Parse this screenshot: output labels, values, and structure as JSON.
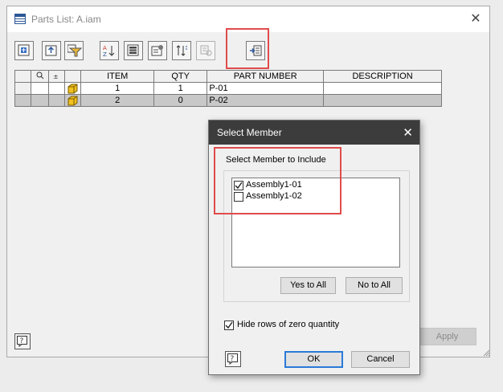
{
  "window": {
    "title": "Parts List: A.iam",
    "close_glyph": "✕"
  },
  "toolbar": {
    "buttons": [
      {
        "name": "member-select-icon"
      },
      {
        "name": "export-icon"
      },
      {
        "name": "filter-funnel-icon"
      },
      {
        "name": "sort-az-icon"
      },
      {
        "name": "column-chooser-icon"
      },
      {
        "name": "group-settings-icon"
      },
      {
        "name": "renumber-icon"
      },
      {
        "name": "settings-grid-icon"
      },
      {
        "name": "member-include-icon"
      }
    ]
  },
  "grid": {
    "columns": [
      "",
      "",
      "",
      "",
      "ITEM",
      "QTY",
      "PART NUMBER",
      "DESCRIPTION"
    ],
    "rows": [
      {
        "item": "1",
        "qty": "1",
        "part_number": "P-01",
        "description": ""
      },
      {
        "item": "2",
        "qty": "0",
        "part_number": "P-02",
        "description": ""
      }
    ]
  },
  "footer": {
    "apply_label": "Apply"
  },
  "dialog": {
    "title": "Select Member",
    "close_glyph": "✕",
    "prompt": "Select Member to Include",
    "members": [
      {
        "label": "Assembly1-01",
        "checked": true
      },
      {
        "label": "Assembly1-02",
        "checked": false
      }
    ],
    "yes_to_all_label": "Yes to All",
    "no_to_all_label": "No to All",
    "hide_zero_label": "Hide rows of zero quantity",
    "hide_zero_checked": true,
    "ok_label": "OK",
    "cancel_label": "Cancel"
  },
  "colors": {
    "highlight": "#e04b4b",
    "selected_row": "#c8c8c8",
    "dialog_titlebar": "#3c3c3c",
    "ok_border": "#2a7ad8",
    "part_cube": "#f0c020"
  }
}
